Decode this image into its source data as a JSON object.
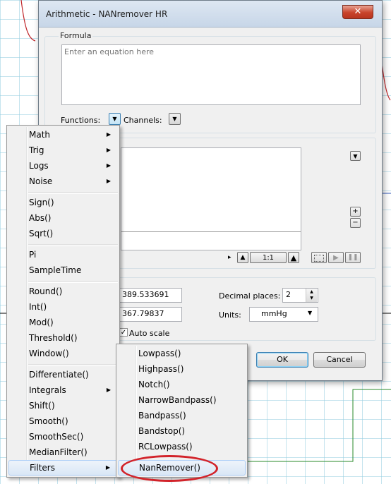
{
  "dialog": {
    "title": "Arithmetic - NANremover HR",
    "close_glyph": "✕",
    "formula_group_label": "Formula",
    "formula_placeholder": "Enter an equation here",
    "functions_label": "Functions:",
    "channels_label": "Channels:",
    "zoom_label": "1:1",
    "value_top": "389.533691",
    "value_bottom": "367.79837",
    "decimal_places_label": "Decimal places:",
    "decimal_places_value": "2",
    "units_label": "Units:",
    "units_value": "mmHg",
    "auto_scale_label": "Auto scale",
    "ok_label": "OK",
    "cancel_label": "Cancel"
  },
  "functions_menu": {
    "items": [
      {
        "label": "Math",
        "submenu": true
      },
      {
        "label": "Trig",
        "submenu": true
      },
      {
        "label": "Logs",
        "submenu": true
      },
      {
        "label": "Noise",
        "submenu": true
      },
      {
        "label": "Sign()"
      },
      {
        "label": "Abs()"
      },
      {
        "label": "Sqrt()"
      },
      {
        "label": "Pi"
      },
      {
        "label": "SampleTime"
      },
      {
        "label": "Round()"
      },
      {
        "label": "Int()"
      },
      {
        "label": "Mod()"
      },
      {
        "label": "Threshold()"
      },
      {
        "label": "Window()"
      },
      {
        "label": "Differentiate()"
      },
      {
        "label": "Integrals",
        "submenu": true
      },
      {
        "label": "Shift()"
      },
      {
        "label": "Smooth()"
      },
      {
        "label": "SmoothSec()"
      },
      {
        "label": "MedianFilter()"
      },
      {
        "label": "Filters",
        "submenu": true,
        "highlighted": true
      }
    ]
  },
  "filters_menu": {
    "items": [
      {
        "label": "Lowpass()"
      },
      {
        "label": "Highpass()"
      },
      {
        "label": "Notch()"
      },
      {
        "label": "NarrowBandpass()"
      },
      {
        "label": "Bandpass()"
      },
      {
        "label": "Bandstop()"
      },
      {
        "label": "RCLowpass()"
      },
      {
        "label": "NanRemover()",
        "highlighted": true,
        "annotated": true
      }
    ]
  },
  "icons": {
    "submenu_arrow": "▶",
    "dropdown_arrow": "▼",
    "plus": "+",
    "minus": "−",
    "triangle_up": "▲",
    "scroll_right": "▸",
    "play": "▶",
    "pause": "❚❚"
  },
  "colors": {
    "annotation_oval": "#d2232a",
    "menu_highlight": "#dae7f6"
  }
}
